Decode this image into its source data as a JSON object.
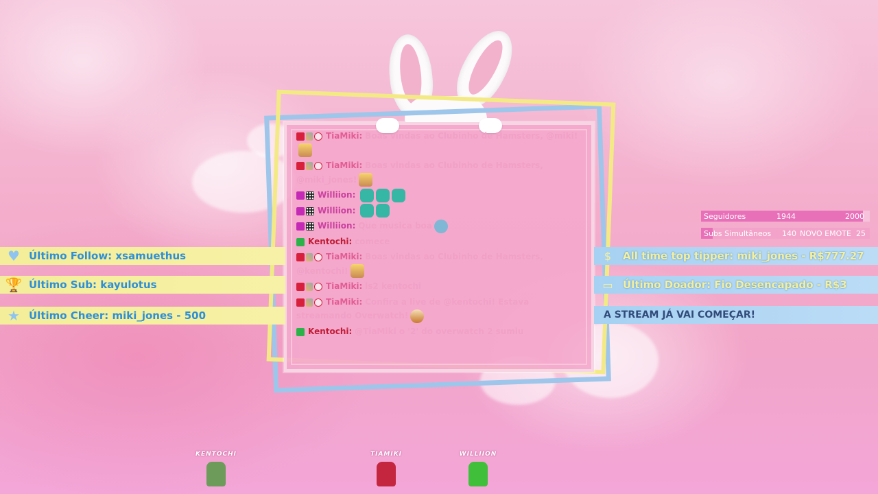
{
  "chat": {
    "messages": [
      {
        "user": "TiaMiki:",
        "text": "Boas vindas ao Clubinho de Hamsters, @miki!",
        "badges": [
          "cam",
          "sword",
          "heart"
        ],
        "emote": "girl"
      },
      {
        "user": "TiaMiki:",
        "text": "Boas vindas ao Clubinho de Hamsters, @miki_jones!",
        "badges": [
          "cam",
          "sword",
          "heart"
        ],
        "emote": "girl"
      },
      {
        "user": "Williion:",
        "text": "",
        "badges": [
          "sub",
          "grid"
        ],
        "emotes": [
          "fish",
          "fish",
          "fish"
        ]
      },
      {
        "user": "Williion:",
        "text": "",
        "badges": [
          "sub",
          "grid"
        ],
        "emotes": [
          "fish",
          "fish"
        ]
      },
      {
        "user": "Williion:",
        "text": "Que musica boa",
        "badges": [
          "sub",
          "grid"
        ],
        "emote": "dino"
      },
      {
        "user": "Kentochi:",
        "text": "comece",
        "badges": [
          "check"
        ]
      },
      {
        "user": "TiaMiki:",
        "text": "Boas vindas ao Clubinho de Hamsters, @kentochi!",
        "badges": [
          "cam",
          "sword",
          "heart"
        ],
        "emote": "girl"
      },
      {
        "user": "TiaMiki:",
        "text": "ls2 kentochi",
        "badges": [
          "cam",
          "sword",
          "heart"
        ]
      },
      {
        "user": "TiaMiki:",
        "text": "Confira a live de @kentochi! Estava streamando Overwatch!",
        "badges": [
          "cam",
          "sword",
          "heart"
        ],
        "emote": "ham"
      },
      {
        "user": "Kentochi:",
        "text": "@TiaMiki o '2' do overwatch 2 sumiu",
        "badges": [
          "check"
        ]
      }
    ]
  },
  "left_bars": {
    "follow": "Último Follow: xsamuethus",
    "sub": "Último Sub: kayulotus",
    "cheer": "Último Cheer: miki_jones - 500"
  },
  "right_bars": {
    "tipper": "All time top tipper: miki_jones - R$777.27",
    "donor": "Último Doador: Fio Desencapado - R$3",
    "announce": "A STREAM JÁ VAI COMEÇAR!"
  },
  "stats": {
    "followers_label": "Seguidores",
    "followers_value": "1944",
    "followers_goal": "2000",
    "followers_progress": 0.972,
    "subs_label": "Subs Simultâneos",
    "subs_value": "140",
    "subs_goal_text": "NOVO EMOTE",
    "subs_goal": "25"
  },
  "avatars": [
    {
      "name": "KENTOCHI",
      "color": "#6c9b5a"
    },
    {
      "name": "TIAMIKI",
      "color": "#c4263f"
    },
    {
      "name": "WILLIION",
      "color": "#3fbf3a"
    }
  ],
  "icons": {
    "follow": "heart-icon",
    "sub": "trophy-icon",
    "cheer": "star-icon",
    "tipper": "money-bag-icon",
    "donor": "cash-icon"
  },
  "colors": {
    "bg_pink": "#f4afcd",
    "frame_yellow": "#f3ea86",
    "frame_blue": "#9ec6ea",
    "bar_yellow": "#f4ee9a",
    "bar_blue": "#a7d1f2",
    "stat_pink": "#e870b8"
  }
}
